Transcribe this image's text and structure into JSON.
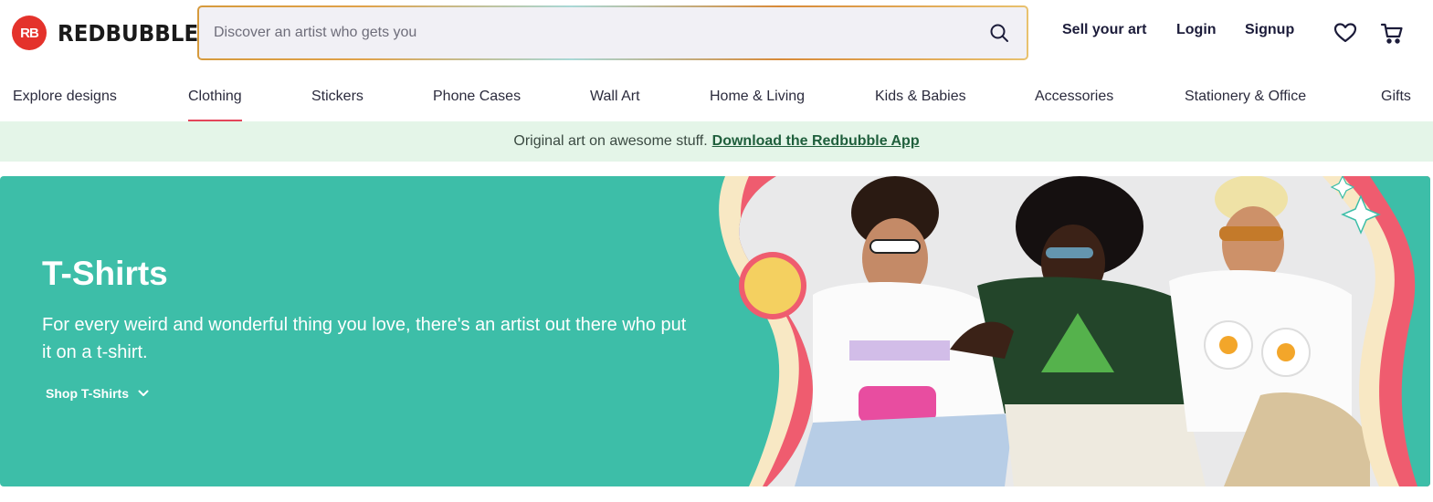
{
  "brand": {
    "name": "REDBUBBLE",
    "badge": "RB"
  },
  "search": {
    "placeholder": "Discover an artist who gets you"
  },
  "header_nav": {
    "sell": "Sell your art",
    "login": "Login",
    "signup": "Signup"
  },
  "icons": {
    "search": "search-icon",
    "wishlist": "heart-icon",
    "cart": "cart-icon",
    "chevron": "chevron-down-icon"
  },
  "categories": [
    "Explore designs",
    "Clothing",
    "Stickers",
    "Phone Cases",
    "Wall Art",
    "Home & Living",
    "Kids & Babies",
    "Accessories",
    "Stationery & Office",
    "Gifts"
  ],
  "active_category": "Clothing",
  "promo": {
    "text": "Original art on awesome stuff.",
    "link": "Download the Redbubble App"
  },
  "hero": {
    "title": "T-Shirts",
    "text": "For every weird and wonderful thing you love, there's an artist out there who put it on a t-shirt.",
    "link": "Shop T-Shirts"
  },
  "colors": {
    "brand_red": "#e4322b",
    "hero_teal": "#3dbea8",
    "promo_bg": "#e4f5e8",
    "active_underline": "#e4455a"
  }
}
